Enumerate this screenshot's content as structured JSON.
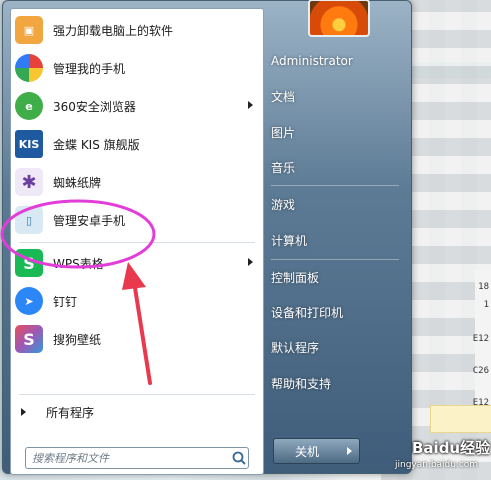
{
  "left_menu": {
    "items": [
      {
        "label": "强力卸载电脑上的软件",
        "icon": "uninstall-box-icon",
        "color": "#f2a640"
      },
      {
        "label": "管理我的手机",
        "icon": "colorful-phone-manager-icon",
        "color": "#e6413b"
      },
      {
        "label": "360安全浏览器",
        "icon": "browser-360-icon",
        "color": "#3fae49",
        "submenu": true
      },
      {
        "label": "金蝶 KIS 旗舰版",
        "icon": "kis-logo-icon",
        "color": "#1f5aa0",
        "icon_text": "KIS"
      },
      {
        "label": "蜘蛛纸牌",
        "icon": "spider-icon",
        "color": "#6b3fa0"
      },
      {
        "label": "管理安卓手机",
        "icon": "android-phone-icon",
        "color": "#7fb3d8"
      },
      {
        "label": "WPS表格",
        "icon": "wps-sheet-icon",
        "color": "#19b955",
        "submenu": true
      },
      {
        "label": "钉钉",
        "icon": "dingtalk-icon",
        "color": "#2b86f7"
      },
      {
        "label": "搜狗壁纸",
        "icon": "sogou-wallpaper-icon",
        "color": "#e84d5b"
      }
    ],
    "all_programs": "所有程序",
    "search_placeholder": "搜索程序和文件"
  },
  "right_menu": {
    "user": "Administrator",
    "items": [
      "文档",
      "图片",
      "音乐",
      "游戏",
      "计算机",
      "控制面板",
      "设备和打印机",
      "默认程序",
      "帮助和支持"
    ]
  },
  "shutdown": {
    "label": "关机"
  },
  "annotation": {
    "color": "#e23dd8",
    "arrow_color": "#e8394f"
  },
  "background_text": {
    "edge": [
      "18",
      "1",
      "E12",
      "C26",
      "E12"
    ]
  },
  "watermark": {
    "brand": "Baidu经验",
    "url": "jingyan.baidu.com"
  }
}
